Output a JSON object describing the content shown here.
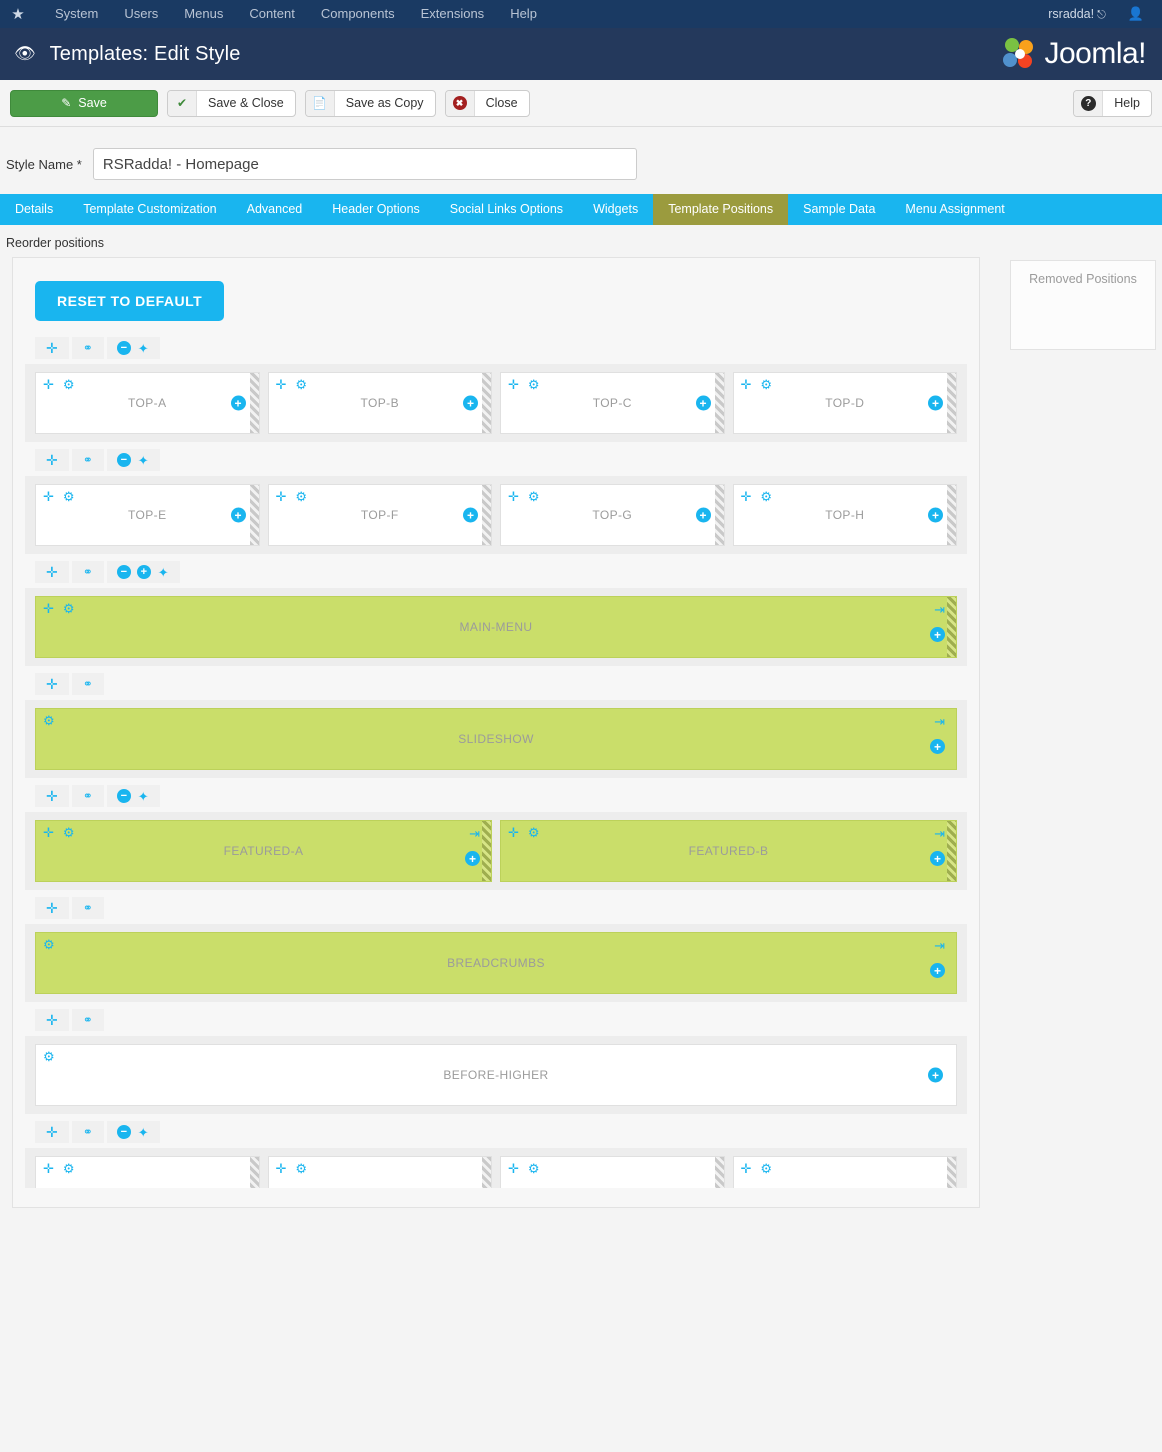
{
  "adminbar": {
    "brand_icon": "joomla-icon",
    "menu": [
      "System",
      "Users",
      "Menus",
      "Content",
      "Components",
      "Extensions",
      "Help"
    ],
    "user": "rsradda!",
    "user_icon": "user-icon",
    "external_icon": "external-link-icon"
  },
  "header": {
    "icon": "eye-icon",
    "title": "Templates: Edit Style",
    "logo_text": "Joomla!"
  },
  "toolbar": {
    "save": "Save",
    "save_icon": "pencil-square-icon",
    "save_close": "Save & Close",
    "save_close_icon": "check-icon",
    "save_copy": "Save as Copy",
    "save_copy_icon": "copy-icon",
    "close": "Close",
    "close_icon": "cancel-circle-icon",
    "help": "Help",
    "help_icon": "question-circle-icon"
  },
  "style": {
    "label": "Style Name *",
    "value": "RSRadda! - Homepage",
    "placeholder": "Style Name"
  },
  "tabs": [
    {
      "label": "Details",
      "active": false
    },
    {
      "label": "Template Customization",
      "active": false
    },
    {
      "label": "Advanced",
      "active": false
    },
    {
      "label": "Header Options",
      "active": false
    },
    {
      "label": "Social Links Options",
      "active": false
    },
    {
      "label": "Widgets",
      "active": false
    },
    {
      "label": "Template Positions",
      "active": true
    },
    {
      "label": "Sample Data",
      "active": false
    },
    {
      "label": "Menu Assignment",
      "active": false
    }
  ],
  "main": {
    "reorder_label": "Reorder positions",
    "reset_button": "RESET TO DEFAULT",
    "removed_positions_title": "Removed Positions"
  },
  "icons": {
    "move": "move-arrows-icon",
    "network": "network-nodes-icon",
    "minus": "minus-circle-icon",
    "plus": "plus-circle-icon",
    "wand": "magic-wand-icon",
    "gear": "gear-icon",
    "export": "insert-module-icon",
    "resize": "resize-handle-icon"
  },
  "rows": [
    {
      "id": "row-top-abcd",
      "tools": [
        "move",
        "network",
        "minus",
        "wand"
      ],
      "cut": false,
      "cells": [
        {
          "label": "TOP-A",
          "green": false,
          "move": true,
          "gear": true,
          "plus": true,
          "export": false,
          "handle": true
        },
        {
          "label": "TOP-B",
          "green": false,
          "move": true,
          "gear": true,
          "plus": true,
          "export": false,
          "handle": true
        },
        {
          "label": "TOP-C",
          "green": false,
          "move": true,
          "gear": true,
          "plus": true,
          "export": false,
          "handle": true
        },
        {
          "label": "TOP-D",
          "green": false,
          "move": true,
          "gear": true,
          "plus": true,
          "export": false,
          "handle": true
        }
      ]
    },
    {
      "id": "row-top-efgh",
      "tools": [
        "move",
        "network",
        "minus",
        "wand"
      ],
      "cut": false,
      "cells": [
        {
          "label": "TOP-E",
          "green": false,
          "move": true,
          "gear": true,
          "plus": true,
          "export": false,
          "handle": true
        },
        {
          "label": "TOP-F",
          "green": false,
          "move": true,
          "gear": true,
          "plus": true,
          "export": false,
          "handle": true
        },
        {
          "label": "TOP-G",
          "green": false,
          "move": true,
          "gear": true,
          "plus": true,
          "export": false,
          "handle": true
        },
        {
          "label": "TOP-H",
          "green": false,
          "move": true,
          "gear": true,
          "plus": true,
          "export": false,
          "handle": true
        }
      ]
    },
    {
      "id": "row-main-menu",
      "tools": [
        "move",
        "network",
        "minus",
        "plus",
        "wand"
      ],
      "cut": false,
      "cells": [
        {
          "label": "MAIN-MENU",
          "green": true,
          "move": true,
          "gear": true,
          "plus": true,
          "export": true,
          "handle": true
        }
      ]
    },
    {
      "id": "row-slideshow",
      "tools": [
        "move",
        "network"
      ],
      "cut": false,
      "cells": [
        {
          "label": "SLIDESHOW",
          "green": true,
          "move": false,
          "gear": true,
          "plus": true,
          "export": true,
          "handle": false
        }
      ]
    },
    {
      "id": "row-featured",
      "tools": [
        "move",
        "network",
        "minus",
        "wand"
      ],
      "cut": false,
      "cells": [
        {
          "label": "FEATURED-A",
          "green": true,
          "move": true,
          "gear": true,
          "plus": true,
          "export": true,
          "handle": true
        },
        {
          "label": "FEATURED-B",
          "green": true,
          "move": true,
          "gear": true,
          "plus": true,
          "export": true,
          "handle": true
        }
      ]
    },
    {
      "id": "row-breadcrumbs",
      "tools": [
        "move",
        "network"
      ],
      "cut": false,
      "cells": [
        {
          "label": "BREADCRUMBS",
          "green": true,
          "move": false,
          "gear": true,
          "plus": true,
          "export": true,
          "handle": false
        }
      ]
    },
    {
      "id": "row-before-higher",
      "tools": [
        "move",
        "network"
      ],
      "cut": false,
      "cells": [
        {
          "label": "BEFORE-HIGHER",
          "green": false,
          "move": false,
          "gear": true,
          "plus": true,
          "export": false,
          "handle": false
        }
      ]
    },
    {
      "id": "row-bottom-cut",
      "tools": [
        "move",
        "network",
        "minus",
        "wand"
      ],
      "cut": true,
      "cells": [
        {
          "label": "",
          "green": false,
          "move": true,
          "gear": true,
          "plus": false,
          "export": false,
          "handle": true
        },
        {
          "label": "",
          "green": false,
          "move": true,
          "gear": true,
          "plus": false,
          "export": false,
          "handle": true
        },
        {
          "label": "",
          "green": false,
          "move": true,
          "gear": true,
          "plus": false,
          "export": false,
          "handle": true
        },
        {
          "label": "",
          "green": false,
          "move": true,
          "gear": true,
          "plus": false,
          "export": false,
          "handle": true
        }
      ]
    }
  ]
}
